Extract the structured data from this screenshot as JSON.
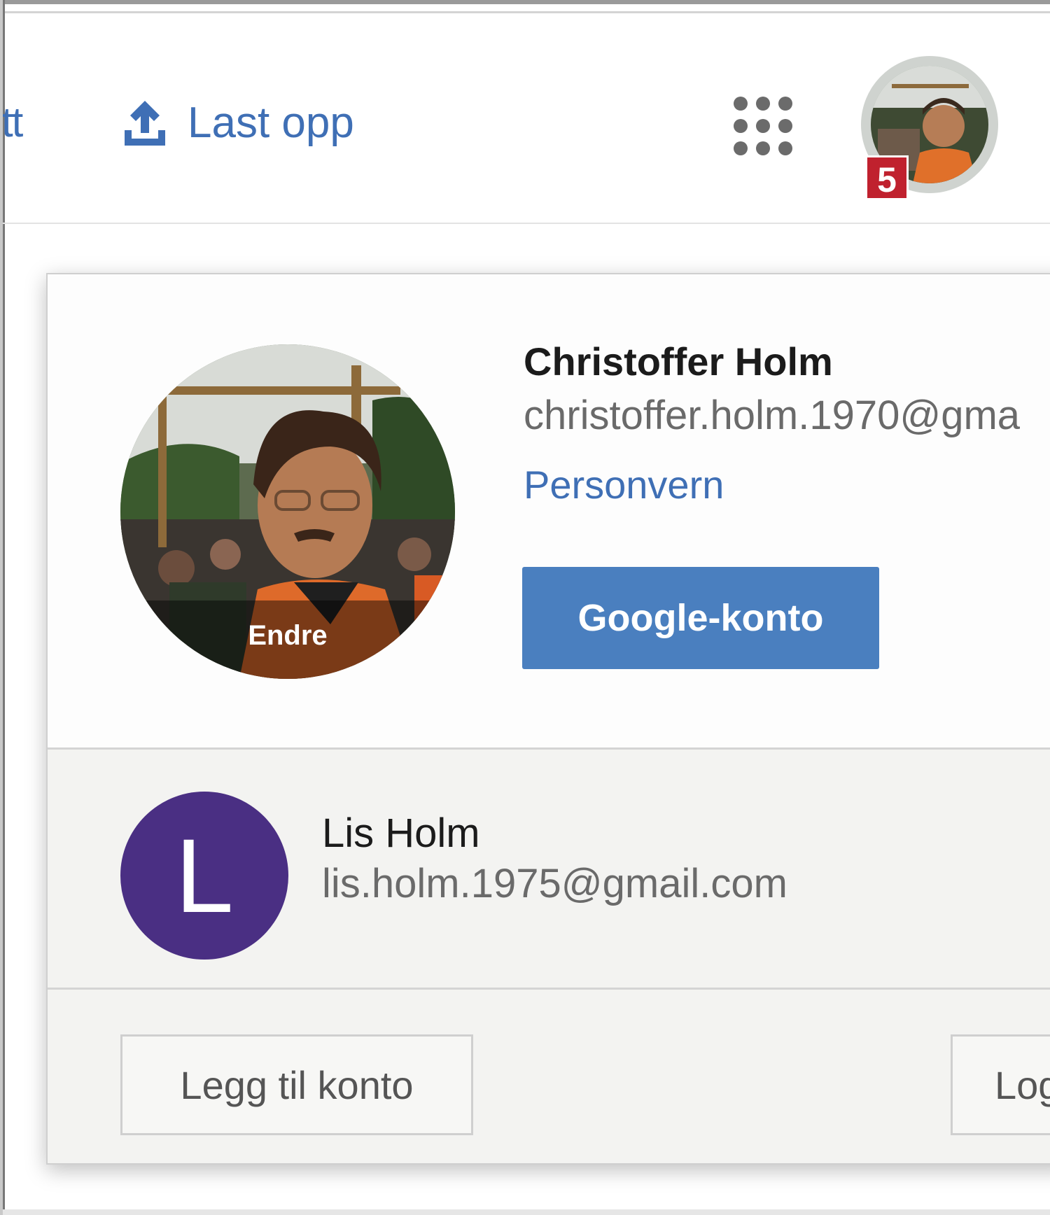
{
  "toolbar": {
    "edge_text": "tt",
    "upload_label": "Last opp",
    "apps_icon": "apps-grid-icon",
    "notification_count": "5",
    "colors": {
      "link": "#3f6fb5",
      "badge": "#c0212e"
    }
  },
  "account_popup": {
    "current_user": {
      "name": "Christoffer Holm",
      "email": "christoffer.holm.1970@gma",
      "change_photo_label": "Endre",
      "privacy_link": "Personvern",
      "account_button": "Google-konto"
    },
    "other_accounts": [
      {
        "initial": "L",
        "name": "Lis Holm",
        "email": "lis.holm.1975@gmail.com",
        "avatar_color": "#4a2f83"
      }
    ],
    "footer": {
      "add_account": "Legg til konto",
      "logout": "Log"
    },
    "colors": {
      "primary_button": "#4a7fbf"
    }
  }
}
